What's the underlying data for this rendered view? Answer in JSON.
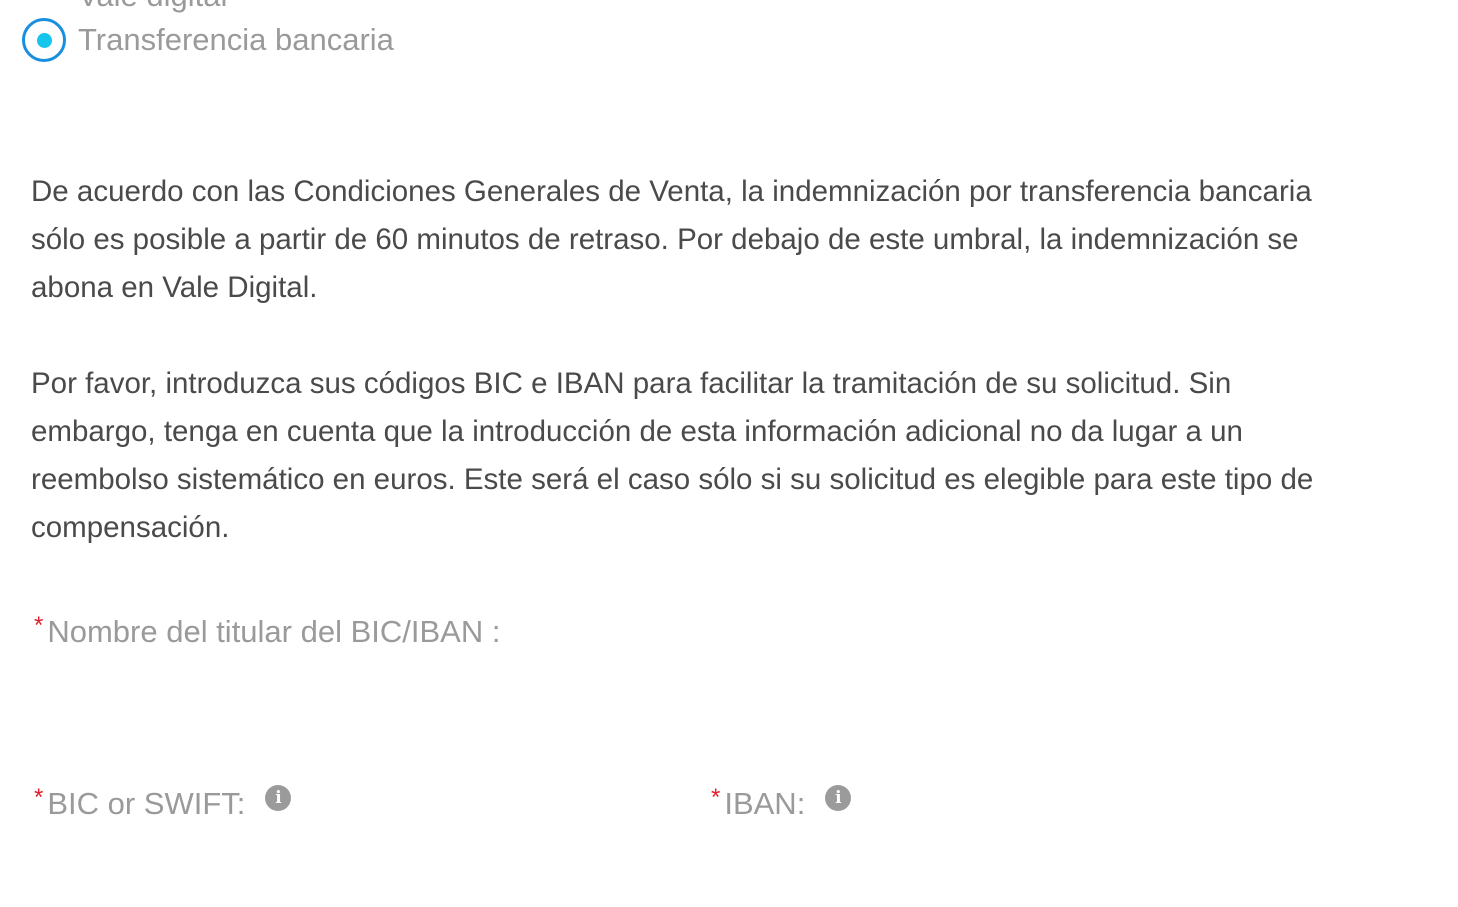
{
  "payment_options": {
    "digital_voucher_label": "Vale digital",
    "bank_transfer_label": "Transferencia bancaria",
    "selected": "Transferencia bancaria"
  },
  "info": {
    "paragraph_1": "De acuerdo con las Condiciones Generales de Venta, la indemnización por transferencia bancaria sólo es posible a partir de 60 minutos de retraso. Por debajo de este umbral, la indemnización se abona en Vale Digital.",
    "paragraph_2": "Por favor, introduzca sus códigos BIC e IBAN para facilitar la tramitación de su solicitud. Sin embargo, tenga en cuenta que la introducción de esta información adicional no da lugar a un reembolso sistemático en euros. Este será el caso sólo si su solicitud es elegible para este tipo de compensación."
  },
  "form": {
    "required_marker": "*",
    "holder_name_label": "Nombre del titular del BIC/IBAN :",
    "bic_label": "BIC or SWIFT:",
    "iban_label": "IBAN:",
    "info_icon_glyph": "i"
  },
  "colors": {
    "radio_border": "#1a8fe0",
    "radio_dot": "#14c6ee",
    "required": "#e0202e",
    "body_text": "#4a4a4a",
    "label_text": "#9a9a9a"
  }
}
